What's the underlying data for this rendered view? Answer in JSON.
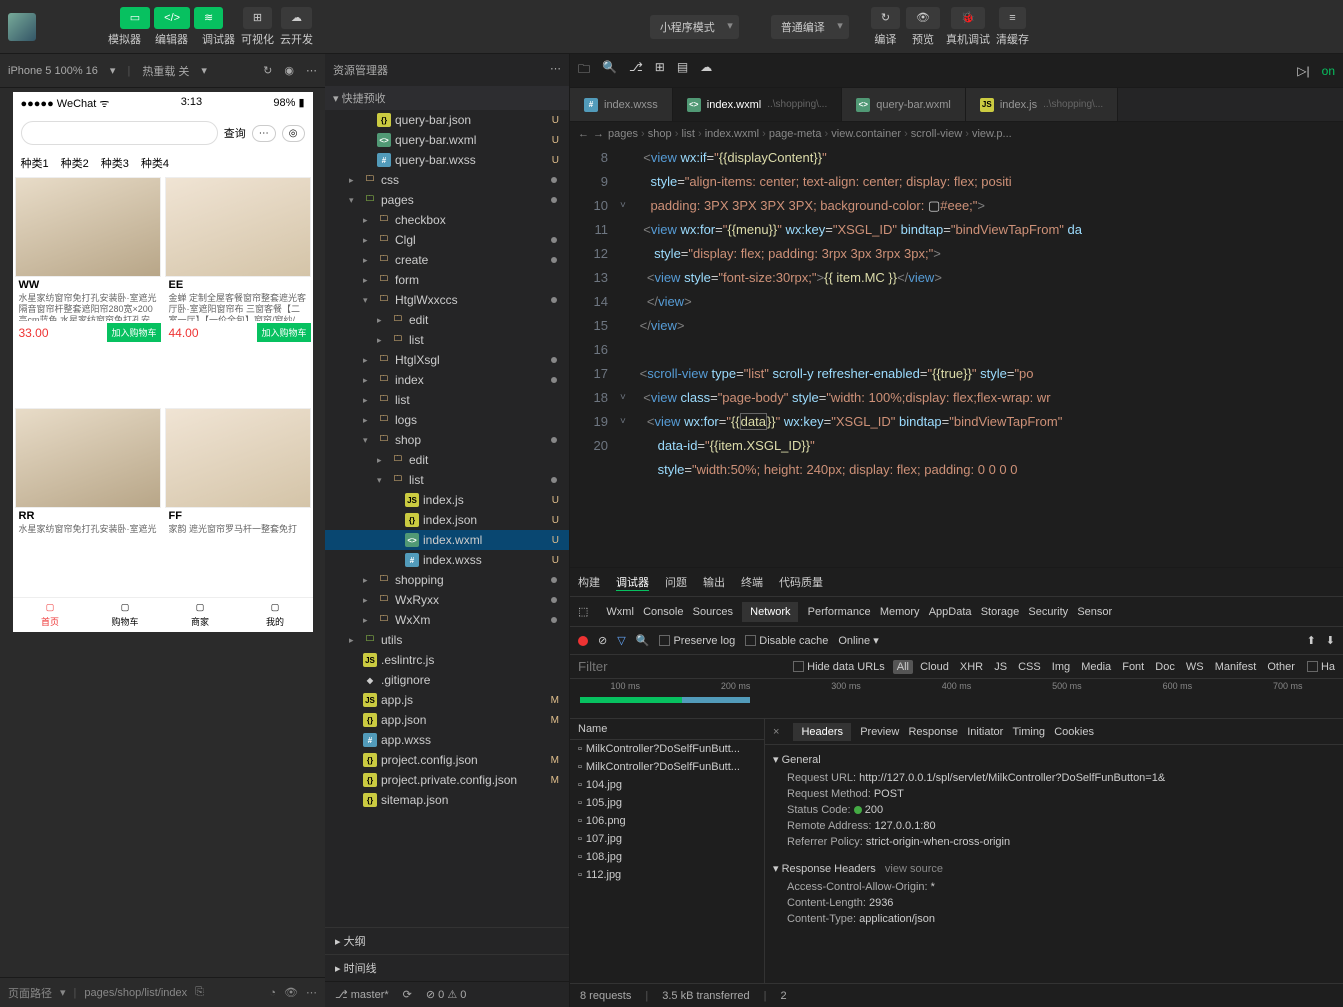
{
  "toolbar": {
    "simulator": "模拟器",
    "editor": "编辑器",
    "debugger": "调试器",
    "visualize": "可视化",
    "cloud": "云开发",
    "mode": "小程序模式",
    "compile": "普通编译",
    "compile_lbl": "编译",
    "preview": "预览",
    "realdebug": "真机调试",
    "clearcache": "清缓存"
  },
  "simHeader": {
    "device": "iPhone 5 100% 16",
    "hotreload": "热重载 关"
  },
  "phone": {
    "carrier": "●●●●● WeChat",
    "wifi": "⌃",
    "time": "3:13",
    "battery": "98%",
    "queryBtn": "查询",
    "cats": [
      "种类1",
      "种类2",
      "种类3",
      "种类4"
    ],
    "products": [
      {
        "title": "WW",
        "desc": "水星家纺窗帘免打孔安装卧·室遮光隔音窗帘杆整套遮阳帘280宽×200高cm蓝色 水星家纺窗帘免打孔安",
        "price": "33.00",
        "btn": "加入购物车"
      },
      {
        "title": "EE",
        "desc": "金蝉 定制全屋客餐窗帘整套遮光客厅卧·室遮阳窗帘布 三窗客餐【二室一厅】【一价全包】窗帘/窗纱/",
        "price": "44.00",
        "btn": "加入购物车"
      },
      {
        "title": "RR",
        "desc": "水星家纺窗帘免打孔安装卧·室遮光",
        "price": "",
        "btn": ""
      },
      {
        "title": "FF",
        "desc": "家韵 遮光窗帘罗马杆一整套免打",
        "price": "",
        "btn": ""
      }
    ],
    "tabs": [
      {
        "l": "首页",
        "a": true
      },
      {
        "l": "购物车"
      },
      {
        "l": "商家"
      },
      {
        "l": "我的"
      }
    ]
  },
  "simFooter": {
    "pathLabel": "页面路径",
    "path": "pages/shop/list/index"
  },
  "explorer": {
    "title": "资源管理器",
    "quick": "快捷预收",
    "items": [
      {
        "d": 2,
        "t": "json",
        "n": "query-bar.json",
        "s": "U"
      },
      {
        "d": 2,
        "t": "wxml",
        "n": "query-bar.wxml",
        "s": "U"
      },
      {
        "d": 2,
        "t": "wxss",
        "n": "query-bar.wxss",
        "s": "U"
      },
      {
        "d": 1,
        "t": "folder",
        "n": "css",
        "c": "▸",
        "dot": true
      },
      {
        "d": 1,
        "t": "folder-g",
        "n": "pages",
        "c": "▾",
        "dot": true
      },
      {
        "d": 2,
        "t": "folder",
        "n": "checkbox",
        "c": "▸"
      },
      {
        "d": 2,
        "t": "folder",
        "n": "Clgl",
        "c": "▸",
        "dot": true
      },
      {
        "d": 2,
        "t": "folder",
        "n": "create",
        "c": "▸",
        "dot": true
      },
      {
        "d": 2,
        "t": "folder",
        "n": "form",
        "c": "▸"
      },
      {
        "d": 2,
        "t": "folder",
        "n": "HtglWxxccs",
        "c": "▾",
        "dot": true
      },
      {
        "d": 3,
        "t": "folder",
        "n": "edit",
        "c": "▸"
      },
      {
        "d": 3,
        "t": "folder",
        "n": "list",
        "c": "▸"
      },
      {
        "d": 2,
        "t": "folder",
        "n": "HtglXsgl",
        "c": "▸",
        "dot": true
      },
      {
        "d": 2,
        "t": "folder",
        "n": "index",
        "c": "▸",
        "dot": true
      },
      {
        "d": 2,
        "t": "folder",
        "n": "list",
        "c": "▸"
      },
      {
        "d": 2,
        "t": "folder",
        "n": "logs",
        "c": "▸"
      },
      {
        "d": 2,
        "t": "folder",
        "n": "shop",
        "c": "▾",
        "dot": true
      },
      {
        "d": 3,
        "t": "folder",
        "n": "edit",
        "c": "▸"
      },
      {
        "d": 3,
        "t": "folder",
        "n": "list",
        "c": "▾",
        "dot": true
      },
      {
        "d": 4,
        "t": "js",
        "n": "index.js",
        "s": "U"
      },
      {
        "d": 4,
        "t": "json",
        "n": "index.json",
        "s": "U"
      },
      {
        "d": 4,
        "t": "wxml",
        "n": "index.wxml",
        "s": "U",
        "sel": true
      },
      {
        "d": 4,
        "t": "wxss",
        "n": "index.wxss",
        "s": "U"
      },
      {
        "d": 2,
        "t": "folder",
        "n": "shopping",
        "c": "▸",
        "dot": true
      },
      {
        "d": 2,
        "t": "folder",
        "n": "WxRyxx",
        "c": "▸",
        "dot": true
      },
      {
        "d": 2,
        "t": "folder",
        "n": "WxXm",
        "c": "▸",
        "dot": true
      },
      {
        "d": 1,
        "t": "folder-g",
        "n": "utils",
        "c": "▸"
      },
      {
        "d": 1,
        "t": "js",
        "n": ".eslintrc.js"
      },
      {
        "d": 1,
        "t": "git",
        "n": ".gitignore"
      },
      {
        "d": 1,
        "t": "js",
        "n": "app.js",
        "s": "M"
      },
      {
        "d": 1,
        "t": "json",
        "n": "app.json",
        "s": "M"
      },
      {
        "d": 1,
        "t": "wxss",
        "n": "app.wxss"
      },
      {
        "d": 1,
        "t": "json",
        "n": "project.config.json",
        "s": "M"
      },
      {
        "d": 1,
        "t": "json",
        "n": "project.private.config.json",
        "s": "M"
      },
      {
        "d": 1,
        "t": "json",
        "n": "sitemap.json"
      }
    ],
    "outline": "大纲",
    "timeline": "时间线"
  },
  "editorTabs": [
    {
      "icon": "wxss",
      "label": "index.wxss"
    },
    {
      "icon": "wxml",
      "label": "index.wxml",
      "path": "..\\shopping\\...",
      "active": true
    },
    {
      "icon": "wxml",
      "label": "query-bar.wxml"
    },
    {
      "icon": "js",
      "label": "index.js",
      "path": "..\\shopping\\..."
    }
  ],
  "breadcrumb": [
    "pages",
    "shop",
    "list",
    "index.wxml",
    "page-meta",
    "view.container",
    "scroll-view",
    "view.p..."
  ],
  "lineNumbers": [
    "",
    "8",
    "9",
    "10",
    "11",
    "12",
    "13",
    "14",
    "15",
    "16",
    "17",
    "18",
    "19",
    "20"
  ],
  "debugger": {
    "tabs1": [
      "构建",
      "调试器",
      "问题",
      "输出",
      "终端",
      "代码质量"
    ],
    "tabs2": [
      "Wxml",
      "Console",
      "Sources",
      "Network",
      "Performance",
      "Memory",
      "AppData",
      "Storage",
      "Security",
      "Sensor"
    ],
    "preserveLog": "Preserve log",
    "disableCache": "Disable cache",
    "online": "Online",
    "filterPh": "Filter",
    "hideData": "Hide data URLs",
    "chips": [
      "All",
      "Cloud",
      "XHR",
      "JS",
      "CSS",
      "Img",
      "Media",
      "Font",
      "Doc",
      "WS",
      "Manifest",
      "Other"
    ],
    "hasBlocked": "Ha",
    "tlLabels": [
      "100 ms",
      "200 ms",
      "300 ms",
      "400 ms",
      "500 ms",
      "600 ms",
      "700 ms"
    ],
    "nameHdr": "Name",
    "requests": [
      "MilkController?DoSelfFunButt...",
      "MilkController?DoSelfFunButt...",
      "104.jpg",
      "105.jpg",
      "106.png",
      "107.jpg",
      "108.jpg",
      "112.jpg"
    ],
    "detailTabs": [
      "Headers",
      "Preview",
      "Response",
      "Initiator",
      "Timing",
      "Cookies"
    ],
    "general": "General",
    "reqUrlK": "Request URL:",
    "reqUrlV": "http://127.0.0.1/spl/servlet/MilkController?DoSelfFunButton=1&",
    "reqMethK": "Request Method:",
    "reqMethV": "POST",
    "statK": "Status Code:",
    "statV": "200",
    "remK": "Remote Address:",
    "remV": "127.0.0.1:80",
    "refK": "Referrer Policy:",
    "refV": "strict-origin-when-cross-origin",
    "respH": "Response Headers",
    "viewSrc": "view source",
    "acaoK": "Access-Control-Allow-Origin:",
    "acaoV": "*",
    "clK": "Content-Length:",
    "clV": "2936",
    "ctK": "Content-Type:",
    "ctV": "application/json",
    "footer": {
      "reqs": "8 requests",
      "transferred": "3.5 kB transferred",
      "res": "2"
    }
  },
  "statusbar": {
    "branch": "master*",
    "errors": "0",
    "warnings": "0"
  }
}
